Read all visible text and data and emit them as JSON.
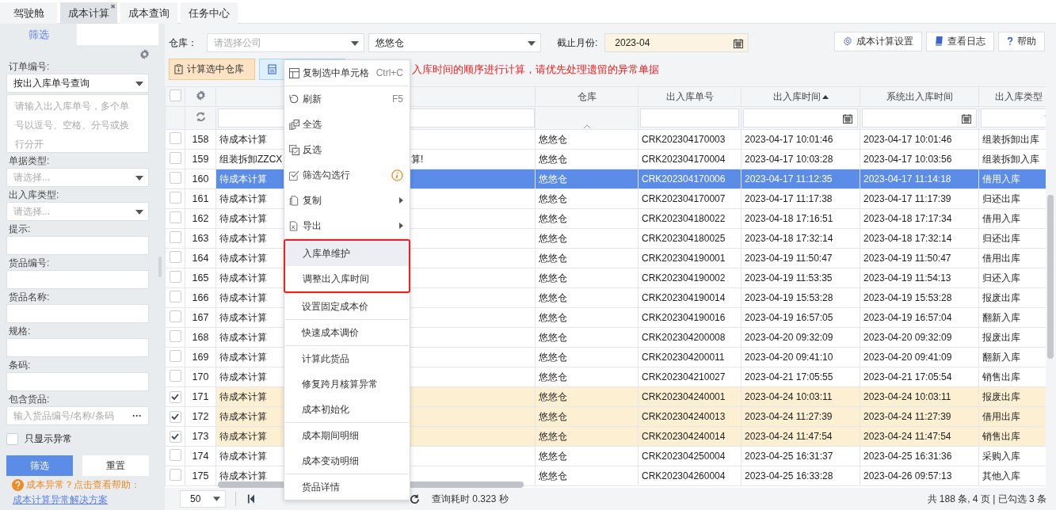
{
  "tabs": [
    {
      "label": "驾驶舱",
      "selected": false
    },
    {
      "label": "成本计算",
      "selected": true,
      "close": "✖"
    },
    {
      "label": "成本查询",
      "selected": false
    },
    {
      "label": "任务中心",
      "selected": false
    }
  ],
  "filter_panel": {
    "tab": "筛选",
    "fields": [
      {
        "label": "订单编号:",
        "kind": "select",
        "value": "按出入库单号查询"
      },
      {
        "kind": "textarea",
        "placeholder": "请输入出入库单号，多个单号以逗号、空格、分号或换行分开"
      },
      {
        "label": "单据类型:",
        "kind": "select",
        "placeholder": "请选择..."
      },
      {
        "label": "出入库类型:",
        "kind": "select",
        "placeholder": "请选择..."
      },
      {
        "label": "提示:",
        "kind": "input"
      },
      {
        "label": "货品编号:",
        "kind": "input"
      },
      {
        "label": "货品名称:",
        "kind": "input"
      },
      {
        "label": "规格:",
        "kind": "input"
      },
      {
        "label": "条码:",
        "kind": "input"
      },
      {
        "label": "包含货品:",
        "kind": "picker",
        "placeholder": "输入货品编号/名称/条码",
        "button": "···"
      }
    ],
    "only_abnormal": {
      "label": "只显示异常",
      "checked": false
    },
    "buttons": [
      "筛选",
      "重置"
    ],
    "help_tip": "成本异常？点击查看帮助：",
    "help_link": "成本计算异常解决方案"
  },
  "toolbar": {
    "warehouse_label": "仓库：",
    "company_placeholder": "请选择公司",
    "warehouse_value": "悠悠仓",
    "month_label": "截止月份:",
    "month_value": "2023-04",
    "right_buttons": [
      "成本计算设置",
      "查看日志",
      "帮助"
    ],
    "action_button": "计算选中仓库",
    "warning": "入库时间的顺序进行计算，请优先处理遗留的异常单据"
  },
  "grid": {
    "select_all_checked": false,
    "columns": [
      {
        "label": "仓库"
      },
      {
        "label": "出入库单号"
      },
      {
        "label": "出入库时间",
        "sort_ascending": true
      },
      {
        "label": "系统出入库时间"
      },
      {
        "label": "出入库类型"
      }
    ],
    "rows": [
      {
        "no": "158",
        "status": "待成本计算",
        "warehouse": "悠悠仓",
        "code": "CRK202304170003",
        "time": "2023-04-17 10:01:46",
        "sys_time": "2023-04-17 10:01:46",
        "type": "组装拆卸出库",
        "checked": false,
        "selected": false
      },
      {
        "no": "159",
        "status": "组装拆卸ZZCX",
        "status_tail": "算!",
        "warehouse": "悠悠仓",
        "code": "CRK202304170004",
        "time": "2023-04-17 10:03:28",
        "sys_time": "2023-04-17 10:03:56",
        "type": "组装拆卸入库",
        "checked": false,
        "selected": false
      },
      {
        "no": "160",
        "status": "待成本计算",
        "warehouse": "悠悠仓",
        "code": "CRK202304170006",
        "time": "2023-04-17 11:12:35",
        "sys_time": "2023-04-17 11:14:18",
        "type": "借用入库",
        "checked": false,
        "selected": true
      },
      {
        "no": "161",
        "status": "待成本计算",
        "warehouse": "悠悠仓",
        "code": "CRK202304170007",
        "time": "2023-04-17 11:17:38",
        "sys_time": "2023-04-17 11:17:39",
        "type": "归还出库",
        "checked": false,
        "selected": false
      },
      {
        "no": "162",
        "status": "待成本计算",
        "warehouse": "悠悠仓",
        "code": "CRK202304180022",
        "time": "2023-04-18 17:16:51",
        "sys_time": "2023-04-18 17:17:34",
        "type": "借用入库",
        "checked": false,
        "selected": false
      },
      {
        "no": "163",
        "status": "待成本计算",
        "warehouse": "悠悠仓",
        "code": "CRK202304180025",
        "time": "2023-04-18 17:32:14",
        "sys_time": "2023-04-18 17:32:14",
        "type": "归还出库",
        "checked": false,
        "selected": false
      },
      {
        "no": "164",
        "status": "待成本计算",
        "warehouse": "悠悠仓",
        "code": "CRK202304190001",
        "time": "2023-04-19 11:50:47",
        "sys_time": "2023-04-19 11:50:47",
        "type": "借用出库",
        "checked": false,
        "selected": false
      },
      {
        "no": "165",
        "status": "待成本计算",
        "warehouse": "悠悠仓",
        "code": "CRK202304190002",
        "time": "2023-04-19 11:53:35",
        "sys_time": "2023-04-19 11:54:13",
        "type": "归还入库",
        "checked": false,
        "selected": false
      },
      {
        "no": "166",
        "status": "待成本计算",
        "warehouse": "悠悠仓",
        "code": "CRK202304190014",
        "time": "2023-04-19 15:53:28",
        "sys_time": "2023-04-19 15:53:28",
        "type": "报废出库",
        "checked": false,
        "selected": false
      },
      {
        "no": "167",
        "status": "待成本计算",
        "warehouse": "悠悠仓",
        "code": "CRK202304190016",
        "time": "2023-04-19 16:57:05",
        "sys_time": "2023-04-19 16:57:04",
        "type": "翻新入库",
        "checked": false,
        "selected": false
      },
      {
        "no": "168",
        "status": "待成本计算",
        "warehouse": "悠悠仓",
        "code": "CRK202304200008",
        "time": "2023-04-20 09:32:09",
        "sys_time": "2023-04-20 09:32:09",
        "type": "报废出库",
        "checked": false,
        "selected": false
      },
      {
        "no": "169",
        "status": "待成本计算",
        "warehouse": "悠悠仓",
        "code": "CRK202304200011",
        "time": "2023-04-20 09:41:10",
        "sys_time": "2023-04-20 09:41:09",
        "type": "翻新入库",
        "checked": false,
        "selected": false
      },
      {
        "no": "170",
        "status": "待成本计算",
        "warehouse": "悠悠仓",
        "code": "CRK202304210027",
        "time": "2023-04-21 17:05:55",
        "sys_time": "2023-04-21 17:05:54",
        "type": "销售出库",
        "checked": false,
        "selected": false
      },
      {
        "no": "171",
        "status": "待成本计算",
        "warehouse": "悠悠仓",
        "code": "CRK202304240001",
        "time": "2023-04-24 10:03:11",
        "sys_time": "2023-04-24 10:03:11",
        "type": "报废出库",
        "checked": true,
        "selected": false
      },
      {
        "no": "172",
        "status": "待成本计算",
        "warehouse": "悠悠仓",
        "code": "CRK202304240013",
        "time": "2023-04-24 11:27:39",
        "sys_time": "2023-04-24 11:27:39",
        "type": "借用出库",
        "checked": true,
        "selected": false
      },
      {
        "no": "173",
        "status": "待成本计算",
        "warehouse": "悠悠仓",
        "code": "CRK202304240014",
        "time": "2023-04-24 11:47:54",
        "sys_time": "2023-04-24 11:47:54",
        "type": "销售出库",
        "checked": true,
        "selected": false
      },
      {
        "no": "174",
        "status": "待成本计算",
        "warehouse": "悠悠仓",
        "code": "CRK202304250004",
        "time": "2023-04-25 16:31:37",
        "sys_time": "2023-04-25 16:31:36",
        "type": "采购入库",
        "checked": false,
        "selected": false
      },
      {
        "no": "175",
        "status": "待成本计算",
        "warehouse": "悠悠仓",
        "code": "CRK202304260004",
        "time": "2023-04-25 16:33:28",
        "sys_time": "2023-04-26 09:57:13",
        "type": "其他入库",
        "checked": false,
        "selected": false
      }
    ]
  },
  "context_menu": {
    "groups": [
      {
        "items": [
          {
            "label": "复制选中单元格",
            "shortcut": "Ctrl+C",
            "selected": false
          }
        ]
      },
      {
        "items": [
          {
            "label": "刷新",
            "shortcut": "F5",
            "selected": false
          },
          {
            "label": "全选",
            "selected": false
          },
          {
            "label": "反选",
            "selected": false
          },
          {
            "label": "筛选勾选行",
            "info": true,
            "selected": false
          },
          {
            "label": "复制",
            "submenu": true,
            "selected": false
          },
          {
            "label": "导出",
            "submenu": true,
            "selected": false
          }
        ]
      },
      {
        "outlined": true,
        "items": [
          {
            "label": "入库单维护",
            "selected": true
          },
          {
            "label": "调整出入库时间",
            "selected": false
          }
        ]
      },
      {
        "items": [
          {
            "label": "设置固定成本价",
            "selected": false
          }
        ]
      },
      {
        "items": [
          {
            "label": "快速成本调价",
            "selected": false
          }
        ]
      },
      {
        "items": [
          {
            "label": "计算此货品",
            "selected": false
          },
          {
            "label": "修复跨月核算异常",
            "selected": false
          },
          {
            "label": "成本初始化",
            "selected": false
          }
        ]
      },
      {
        "items": [
          {
            "label": "成本期间明细",
            "selected": false
          },
          {
            "label": "成本变动明细",
            "selected": false
          }
        ]
      },
      {
        "items": [
          {
            "label": "货品详情",
            "selected": false
          }
        ]
      }
    ]
  },
  "footer": {
    "page_size": "50",
    "query_time": "查询耗时 0.323 秒",
    "summary": "共 188 条, 4 页 | 已勾选 3 条"
  }
}
